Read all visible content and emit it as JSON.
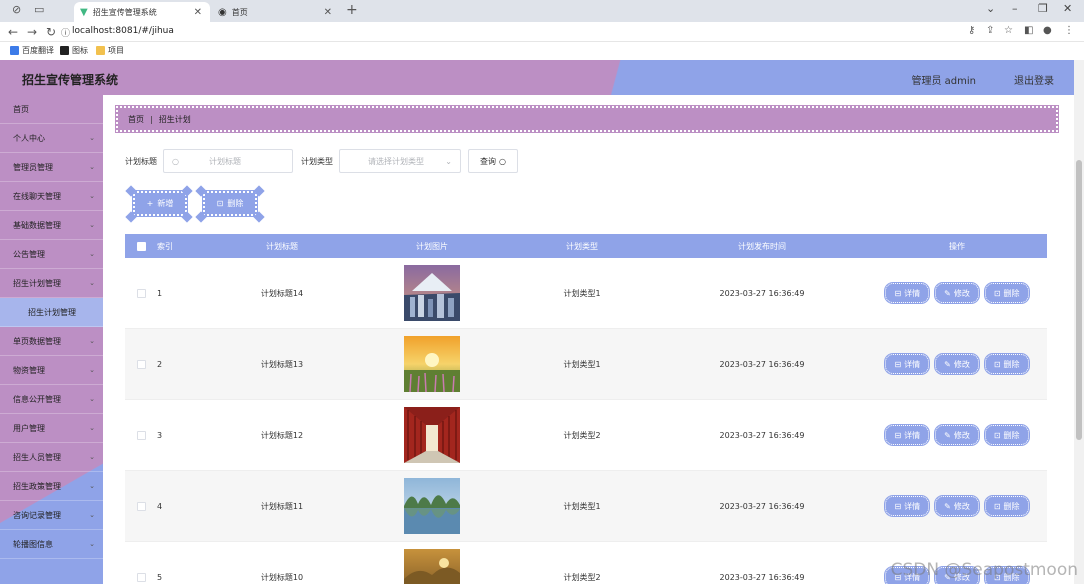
{
  "browser": {
    "tabs": [
      {
        "title": "招生宣传管理系统",
        "icon": "vue-logo-icon",
        "active": true
      },
      {
        "title": "首页",
        "icon": "globe-icon",
        "active": false
      }
    ],
    "url": "localhost:8081/#/jihua",
    "bookmarks": [
      {
        "label": "百度翻译",
        "color": "#3c7be8"
      },
      {
        "label": "图标",
        "color": "#222222"
      },
      {
        "label": "项目",
        "color": "#f2c14e"
      }
    ]
  },
  "header": {
    "title": "招生宣传管理系统",
    "user": "管理员 admin",
    "logout": "退出登录"
  },
  "sidebar": {
    "items": [
      {
        "label": "首页",
        "expandable": false
      },
      {
        "label": "个人中心",
        "expandable": true
      },
      {
        "label": "管理员管理",
        "expandable": true
      },
      {
        "label": "在线聊天管理",
        "expandable": true
      },
      {
        "label": "基础数据管理",
        "expandable": true
      },
      {
        "label": "公告管理",
        "expandable": true
      },
      {
        "label": "招生计划管理",
        "expandable": true
      },
      {
        "label": "招生计划管理",
        "expandable": false,
        "sub": true
      },
      {
        "label": "单页数据管理",
        "expandable": true
      },
      {
        "label": "物资管理",
        "expandable": true
      },
      {
        "label": "信息公开管理",
        "expandable": true
      },
      {
        "label": "用户管理",
        "expandable": true
      },
      {
        "label": "招生人员管理",
        "expandable": true
      },
      {
        "label": "招生政策管理",
        "expandable": true
      },
      {
        "label": "咨询记录管理",
        "expandable": true
      },
      {
        "label": "轮播图信息",
        "expandable": true
      }
    ]
  },
  "breadcrumb": {
    "home": "首页",
    "current": "招生计划"
  },
  "search": {
    "title_label": "计划标题",
    "title_placeholder": "计划标题",
    "type_label": "计划类型",
    "type_placeholder": "请选择计划类型",
    "query_label": "查询"
  },
  "actions": {
    "add_label": "新增",
    "delete_label": "删除"
  },
  "table": {
    "headers": {
      "index": "索引",
      "title": "计划标题",
      "image": "计划图片",
      "type": "计划类型",
      "time": "计划发布时间",
      "ops": "操作"
    },
    "ops": {
      "detail": "详情",
      "edit": "修改",
      "delete": "删除"
    },
    "rows": [
      {
        "index": "1",
        "title": "计划标题14",
        "type": "计划类型1",
        "time": "2023-03-27 16:36:49",
        "image": "mountain-city"
      },
      {
        "index": "2",
        "title": "计划标题13",
        "type": "计划类型1",
        "time": "2023-03-27 16:36:49",
        "image": "sunset-field"
      },
      {
        "index": "3",
        "title": "计划标题12",
        "type": "计划类型2",
        "time": "2023-03-27 16:36:49",
        "image": "red-corridor"
      },
      {
        "index": "4",
        "title": "计划标题11",
        "type": "计划类型1",
        "time": "2023-03-27 16:36:49",
        "image": "lake-hills"
      },
      {
        "index": "5",
        "title": "计划标题10",
        "type": "计划类型2",
        "time": "2023-03-27 16:36:49",
        "image": "golden-valley"
      }
    ]
  },
  "watermark": "CSDN @Seapostmoon",
  "colors": {
    "purple": "#bc8fc4",
    "blue": "#8fa3e8"
  }
}
